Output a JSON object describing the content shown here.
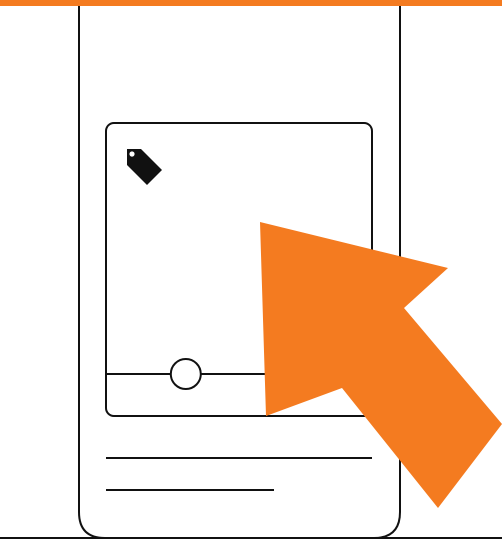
{
  "colors": {
    "accent": "#F47B20",
    "stroke": "#111111",
    "background": "#FFFFFF"
  },
  "icons": {
    "tag": "price-tag-icon",
    "pointer": "cursor-arrow-icon",
    "handle": "slider-handle-icon"
  },
  "slider": {
    "value": 0.3
  }
}
